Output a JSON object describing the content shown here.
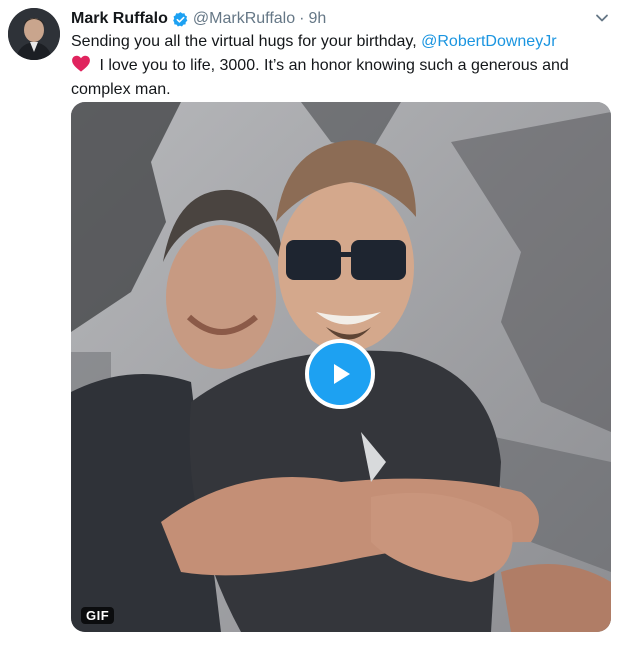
{
  "tweet": {
    "author_name": "Mark Ruffalo",
    "handle": "@MarkRuffalo",
    "separator": "·",
    "time": "9h",
    "text_part1": "Sending you all the virtual hugs for your birthday, ",
    "mention": "@RobertDowneyJr",
    "text_part2": " I love you to life, 3000. It’s an honor knowing such a generous and complex man.",
    "media_badge": "GIF"
  },
  "colors": {
    "link": "#1b95e0",
    "play_button": "#1da1f2",
    "verified_badge": "#1da1f2",
    "heart": "#e0245e",
    "secondary_text": "#657786"
  },
  "icons": {
    "verified": "verified-badge-icon",
    "caret": "chevron-down-icon",
    "heart": "red-heart-emoji",
    "play": "play-icon"
  }
}
